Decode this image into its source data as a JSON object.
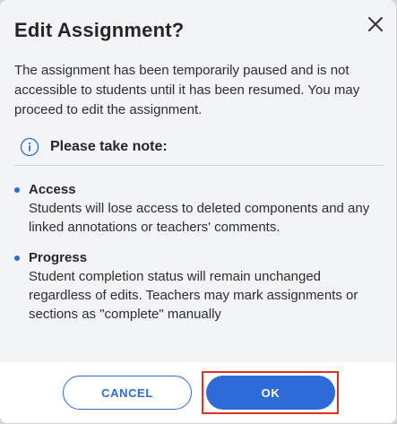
{
  "dialog": {
    "title": "Edit Assignment?",
    "close_icon": "close-icon",
    "intro": "The assignment has been temporarily paused and is not accessible to students until it has been resumed. You may proceed to edit the assignment.",
    "note_icon": "info-icon",
    "note_title": "Please take note:",
    "items": [
      {
        "heading": "Access",
        "body": "Students will lose access to deleted components and any linked annotations or teachers' comments."
      },
      {
        "heading": "Progress",
        "body": "Student completion status will remain unchanged regardless of edits. Teachers may mark assignments or sections as \"complete\" manually"
      }
    ]
  },
  "footer": {
    "cancel_label": "CANCEL",
    "ok_label": "OK"
  },
  "colors": {
    "accent": "#2e6bd6",
    "highlight": "#e0321e",
    "background": "#f3f4f6"
  }
}
